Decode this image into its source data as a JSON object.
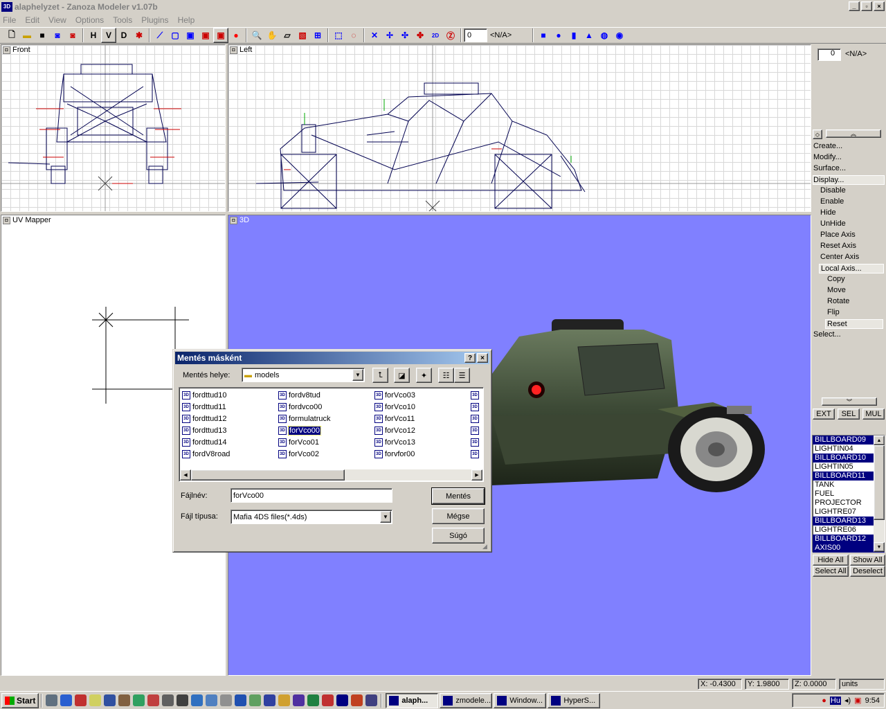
{
  "window": {
    "title": "alaphelyzet - Zanoza Modeler v1.07b",
    "app_icon": "3D"
  },
  "menu": [
    "File",
    "Edit",
    "View",
    "Options",
    "Tools",
    "Plugins",
    "Help"
  ],
  "toolbar": {
    "labels": {
      "h": "H",
      "v": "V",
      "d": "D"
    },
    "field_value": "0",
    "field_text": "<N/A>"
  },
  "viewports": {
    "front": "Front",
    "left": "Left",
    "uv": "UV Mapper",
    "three_d": "3D"
  },
  "right_panel": {
    "spin_value": "0",
    "spin_text": "<N/A>",
    "menu": [
      "Create...",
      "Modify...",
      "Surface...",
      "Display..."
    ],
    "display_sub": [
      "Disable",
      "Enable",
      "Hide",
      "UnHide",
      "Place Axis",
      "Reset Axis",
      "Center Axis",
      "Local Axis..."
    ],
    "local_sub": [
      "Copy",
      "Move",
      "Rotate",
      "Flip",
      "Reset"
    ],
    "select": "Select...",
    "mode_buttons": [
      "EXT",
      "SEL",
      "MUL"
    ],
    "objects": [
      {
        "name": "BILLBOARD09",
        "selected": true
      },
      {
        "name": "LIGHTIN04",
        "selected": false
      },
      {
        "name": "BILLBOARD10",
        "selected": true
      },
      {
        "name": "LIGHTIN05",
        "selected": false
      },
      {
        "name": "BILLBOARD11",
        "selected": true
      },
      {
        "name": "TANK",
        "selected": false
      },
      {
        "name": "FUEL",
        "selected": false
      },
      {
        "name": "PROJECTOR",
        "selected": false
      },
      {
        "name": "LIGHTRE07",
        "selected": false
      },
      {
        "name": "BILLBOARD13",
        "selected": true
      },
      {
        "name": "LIGHTRE06",
        "selected": false
      },
      {
        "name": "BILLBOARD12",
        "selected": true
      },
      {
        "name": "AXIS00",
        "selected": true
      }
    ],
    "hide_all": "Hide All",
    "show_all": "Show All",
    "select_all": "Select All",
    "deselect": "Deselect"
  },
  "status": {
    "x": "X: -0.4300",
    "y": "Y: 1.9800",
    "z": "Z: 0.0000",
    "units": "units"
  },
  "dialog": {
    "title": "Mentés másként",
    "help_btn": "?",
    "close_btn": "×",
    "location_label": "Mentés helye:",
    "location_value": "models",
    "files": [
      [
        "fordttud10",
        "fordttud11",
        "fordttud12",
        "fordttud13",
        "fordttud14",
        "fordV8road"
      ],
      [
        "fordv8tud",
        "fordvco00",
        "formulatruck",
        "forVco00",
        "forVco01",
        "forVco02"
      ],
      [
        "forVco03",
        "forVco10",
        "forVco11",
        "forVco12",
        "forVco13",
        "forvfor00"
      ]
    ],
    "selected_file": "forVco00",
    "filename_label": "Fájlnév:",
    "filename_value": "forVco00",
    "filetype_label": "Fájl típusa:",
    "filetype_value": "Mafia 4DS files(*.4ds)",
    "save_btn": "Mentés",
    "cancel_btn": "Mégse",
    "help_text_btn": "Súgó"
  },
  "taskbar": {
    "start": "Start",
    "tasks": [
      {
        "label": "alaph...",
        "active": true
      },
      {
        "label": "zmodele...",
        "active": false
      },
      {
        "label": "Window...",
        "active": false
      },
      {
        "label": "HyperS...",
        "active": false
      }
    ],
    "tray_lang": "Hu",
    "clock": "9:54"
  },
  "colors": {
    "viewport_3d_bg": "#8080ff",
    "selection": "#000080",
    "wire": "#000040"
  }
}
